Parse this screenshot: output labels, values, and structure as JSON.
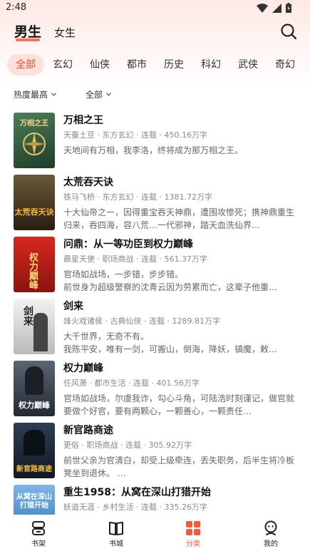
{
  "status_bar": {
    "time": "2:48"
  },
  "header": {
    "tabs": [
      {
        "label": "男生",
        "active": true
      },
      {
        "label": "女生",
        "active": false
      }
    ]
  },
  "categories": [
    {
      "label": "全部",
      "active": true
    },
    {
      "label": "玄幻",
      "active": false
    },
    {
      "label": "仙侠",
      "active": false
    },
    {
      "label": "都市",
      "active": false
    },
    {
      "label": "历史",
      "active": false
    },
    {
      "label": "科幻",
      "active": false
    },
    {
      "label": "武侠",
      "active": false
    },
    {
      "label": "奇幻",
      "active": false
    }
  ],
  "filters": {
    "sort": "热度最高",
    "status": "全部"
  },
  "books": [
    {
      "title": "万相之王",
      "meta": "天蚕土豆 · 东方玄幻 · 连载 · 450.16万字",
      "desc": "天地间有万相，我李洛，终将成为那万相之王。",
      "cover_text": "万相之王",
      "cover_color": "#2f5a3c"
    },
    {
      "title": "太荒吞天诀",
      "meta": "铁马飞桥 · 东方玄幻 · 连载 · 1381.72万字",
      "desc": "十大仙帝之一，因得重宝吞天神鼎，遭围攻惨死；携神鼎重生归来，吞四海，容八荒…一代邪神，踏天血洗仙界…",
      "cover_text": "太荒吞天诀",
      "cover_color": "#2a2218"
    },
    {
      "title": "问鼎：从一等功臣到权力巅峰",
      "meta": "晨星天使 · 职场商战 · 连载 · 561.37万字",
      "desc": "官场如战场，一步错，步步错。\n前世身为超级警察的沈青云因为劳累而亡，这辈子他重…",
      "cover_text": "权力巅峰",
      "cover_color": "#b8201a"
    },
    {
      "title": "剑来",
      "meta": "烽火戏诸侯 · 古典仙侠 · 连载 · 1289.81万字",
      "desc": "大千世界，无奇不有。\n我陈平安，唯有一剑，可搬山，倒海，降妖，镇魔，敕…",
      "cover_text": "剑来",
      "cover_color": "#e6e6e6"
    },
    {
      "title": "权力巅峰",
      "meta": "任风萧 · 都市生活 · 连载 · 401.56万字",
      "desc": "官场如战场，尔虞我诈，勾心斗角，可陆浩时刻谨记，做官就要做个好官，要有两颗心，一颗善心，一颗责任…",
      "cover_text": "权力巅峰",
      "cover_color": "#3d4552"
    },
    {
      "title": "新官路商途",
      "meta": "更俗 · 职场商战 · 连载 · 305.92万字",
      "desc": "前世父亲为官清白，却受上级牵连，丢失职务，后半生将冷板凳坐到退休。 …",
      "cover_text": "新官路商途",
      "cover_color": "#1f2a3a"
    },
    {
      "title": "重生1958：从窝在深山打猎开始",
      "meta": "妖道无涯 · 乡村生活 · 连载 · 335.26万字",
      "desc": "",
      "cover_text": "从窝在深山打猎开始",
      "cover_color": "#2a6fb0"
    }
  ],
  "bottom_nav": [
    {
      "label": "书架",
      "icon": "bookshelf-icon",
      "active": false
    },
    {
      "label": "书城",
      "icon": "book-store-icon",
      "active": false
    },
    {
      "label": "分类",
      "icon": "category-icon",
      "active": true
    },
    {
      "label": "我的",
      "icon": "profile-icon",
      "active": false
    }
  ],
  "colors": {
    "accent": "#f25a3c",
    "chip_bg": "#fde2dc"
  }
}
